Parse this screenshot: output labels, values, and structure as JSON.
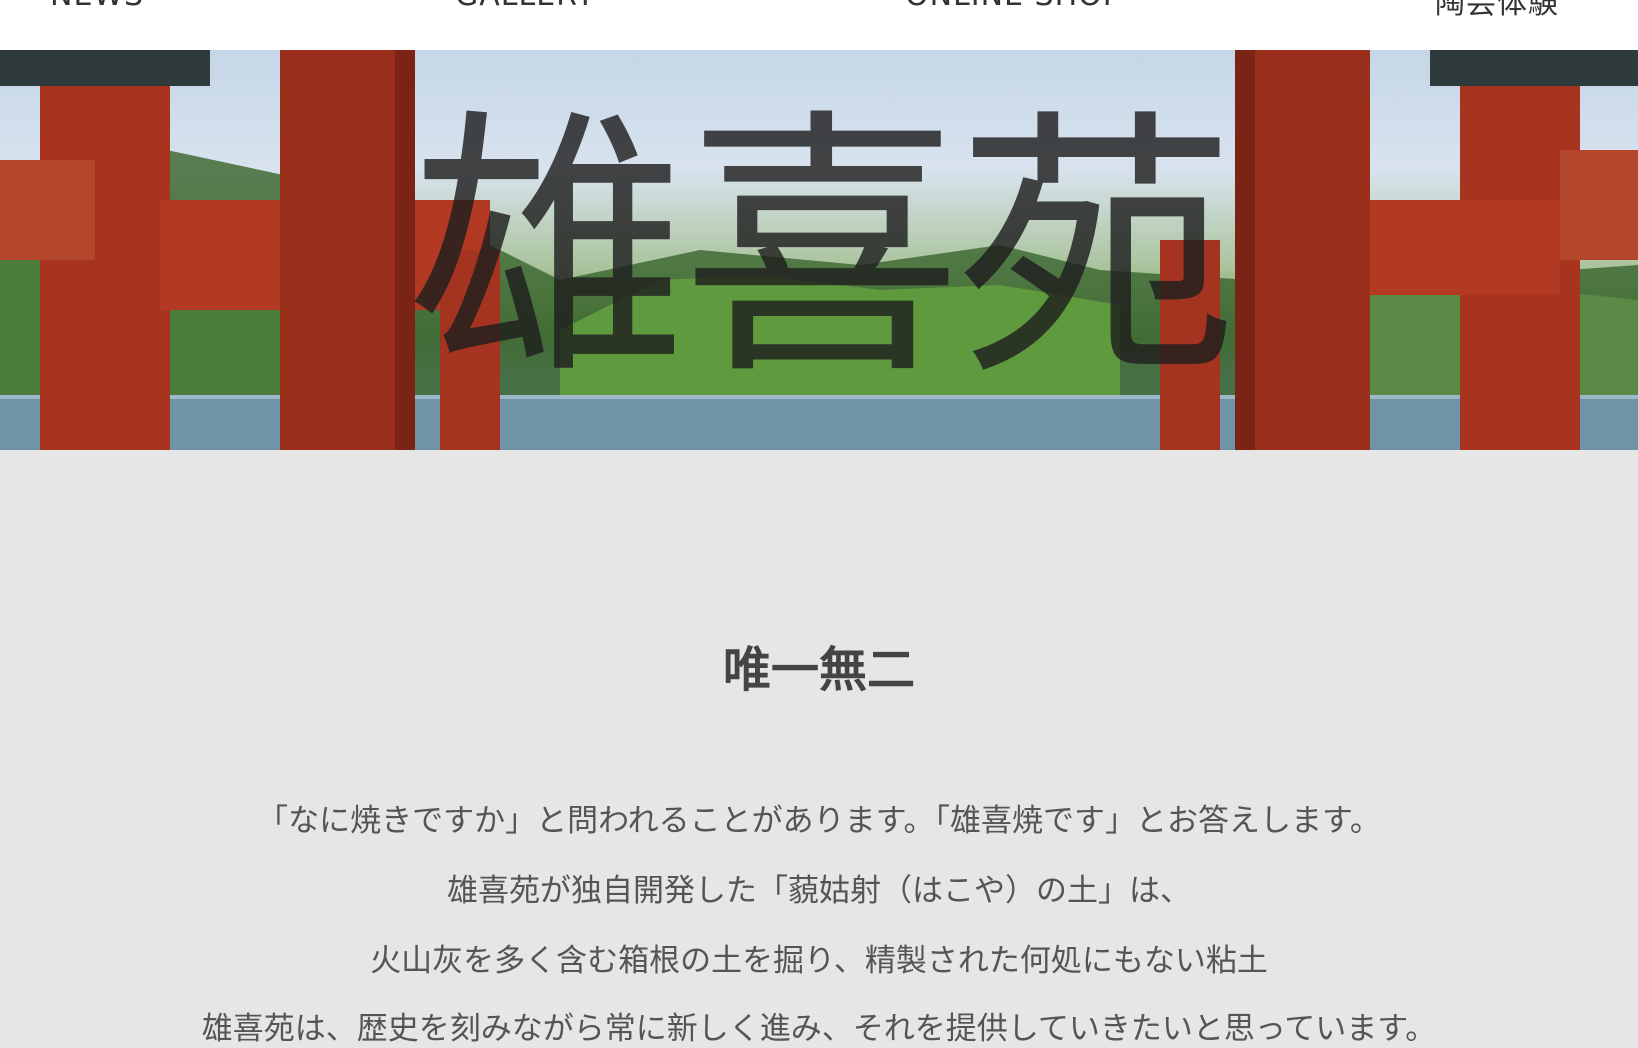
{
  "nav": {
    "items": [
      {
        "label": "NEWS"
      },
      {
        "label": "GALLERY"
      },
      {
        "label": "ONLINE SHOP"
      },
      {
        "label": "陶芸体験"
      }
    ]
  },
  "hero": {
    "title": "雄喜苑"
  },
  "intro": {
    "heading": "唯一無二",
    "lines": [
      "「なに焼きですか」と問われることがあります。「雄喜焼です」とお答えします。",
      "雄喜苑が独自開発した「藐姑射（はこや）の土」は、",
      "火山灰を多く含む箱根の土を掘り、精製された何処にもない粘土",
      "雄喜苑は、歴史を刻みながら常に新しく進み、それを提供していきたいと思っています。"
    ]
  },
  "colors": {
    "background": "#e6e6e6",
    "nav_background": "#ffffff",
    "torii_red": "#b23a22",
    "torii_dark": "#2e3a3c"
  }
}
